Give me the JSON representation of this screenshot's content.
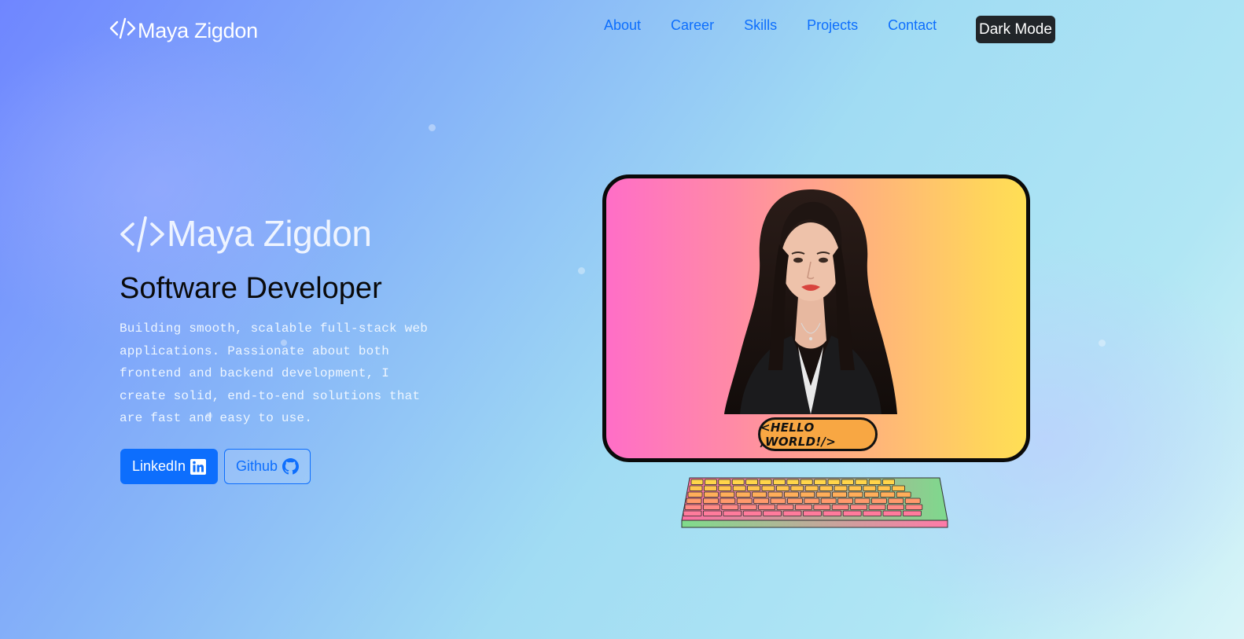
{
  "nav": {
    "brand": "Maya Zigdon",
    "links": [
      "About",
      "Career",
      "Skills",
      "Projects",
      "Contact"
    ],
    "dark_mode_label": "Dark Mode"
  },
  "hero": {
    "name": "Maya Zigdon",
    "title": "Software Developer",
    "description": "Building smooth, scalable full-stack web applications. Passionate about both frontend and backend development, I create solid, end-to-end solutions that are fast and easy to use.",
    "linkedin_label": "LinkedIn",
    "github_label": "Github"
  },
  "illustration": {
    "badge_text": "<HELLO ,WORLD!/>"
  },
  "colors": {
    "accent": "#0d6efd",
    "dark_button": "#212529",
    "screen_gradient": [
      "#ff6ec7",
      "#ffdf55"
    ]
  },
  "icons": [
    "code-icon",
    "linkedin-icon",
    "github-icon"
  ]
}
